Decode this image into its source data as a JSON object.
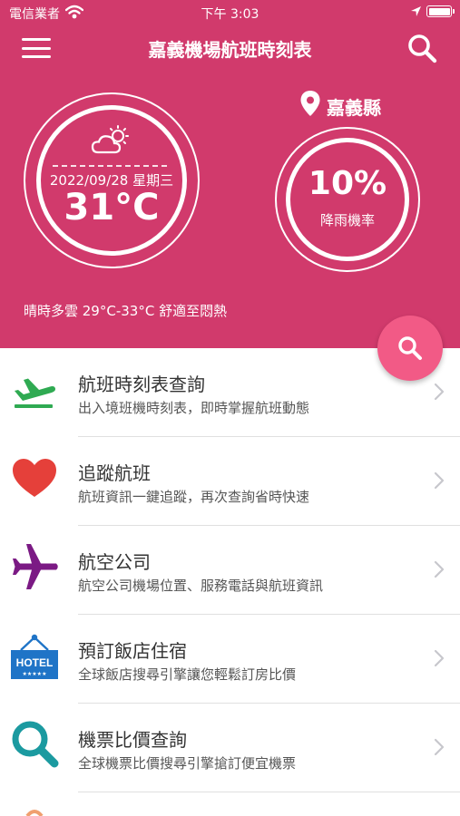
{
  "status_bar": {
    "carrier": "電信業者",
    "time": "下午 3:03"
  },
  "header": {
    "title": "嘉義機場航班時刻表"
  },
  "weather": {
    "date": "2022/09/28 星期三",
    "temperature": "31°C",
    "location": "嘉義縣",
    "rain_percent": "10%",
    "rain_label": "降雨機率",
    "summary": "晴時多雲 29°C-33°C 舒適至悶熱"
  },
  "colors": {
    "brand": "#d13a6c",
    "fab": "#f25a86"
  },
  "menu": {
    "items": [
      {
        "title": "航班時刻表查詢",
        "subtitle": "出入境班機時刻表，即時掌握航班動態",
        "icon": "airplane-departure-icon"
      },
      {
        "title": "追蹤航班",
        "subtitle": "航班資訊一鍵追蹤，再次查詢省時快速",
        "icon": "heart-icon"
      },
      {
        "title": "航空公司",
        "subtitle": "航空公司機場位置、服務電話與航班資訊",
        "icon": "airplane-icon"
      },
      {
        "title": "預訂飯店住宿",
        "subtitle": "全球飯店搜尋引擎讓您輕鬆訂房比價",
        "icon": "hotel-sign-icon",
        "icon_text": "HOTEL"
      },
      {
        "title": "機票比價查詢",
        "subtitle": "全球機票比價搜尋引擎搶訂便宜機票",
        "icon": "magnifier-icon"
      }
    ]
  }
}
